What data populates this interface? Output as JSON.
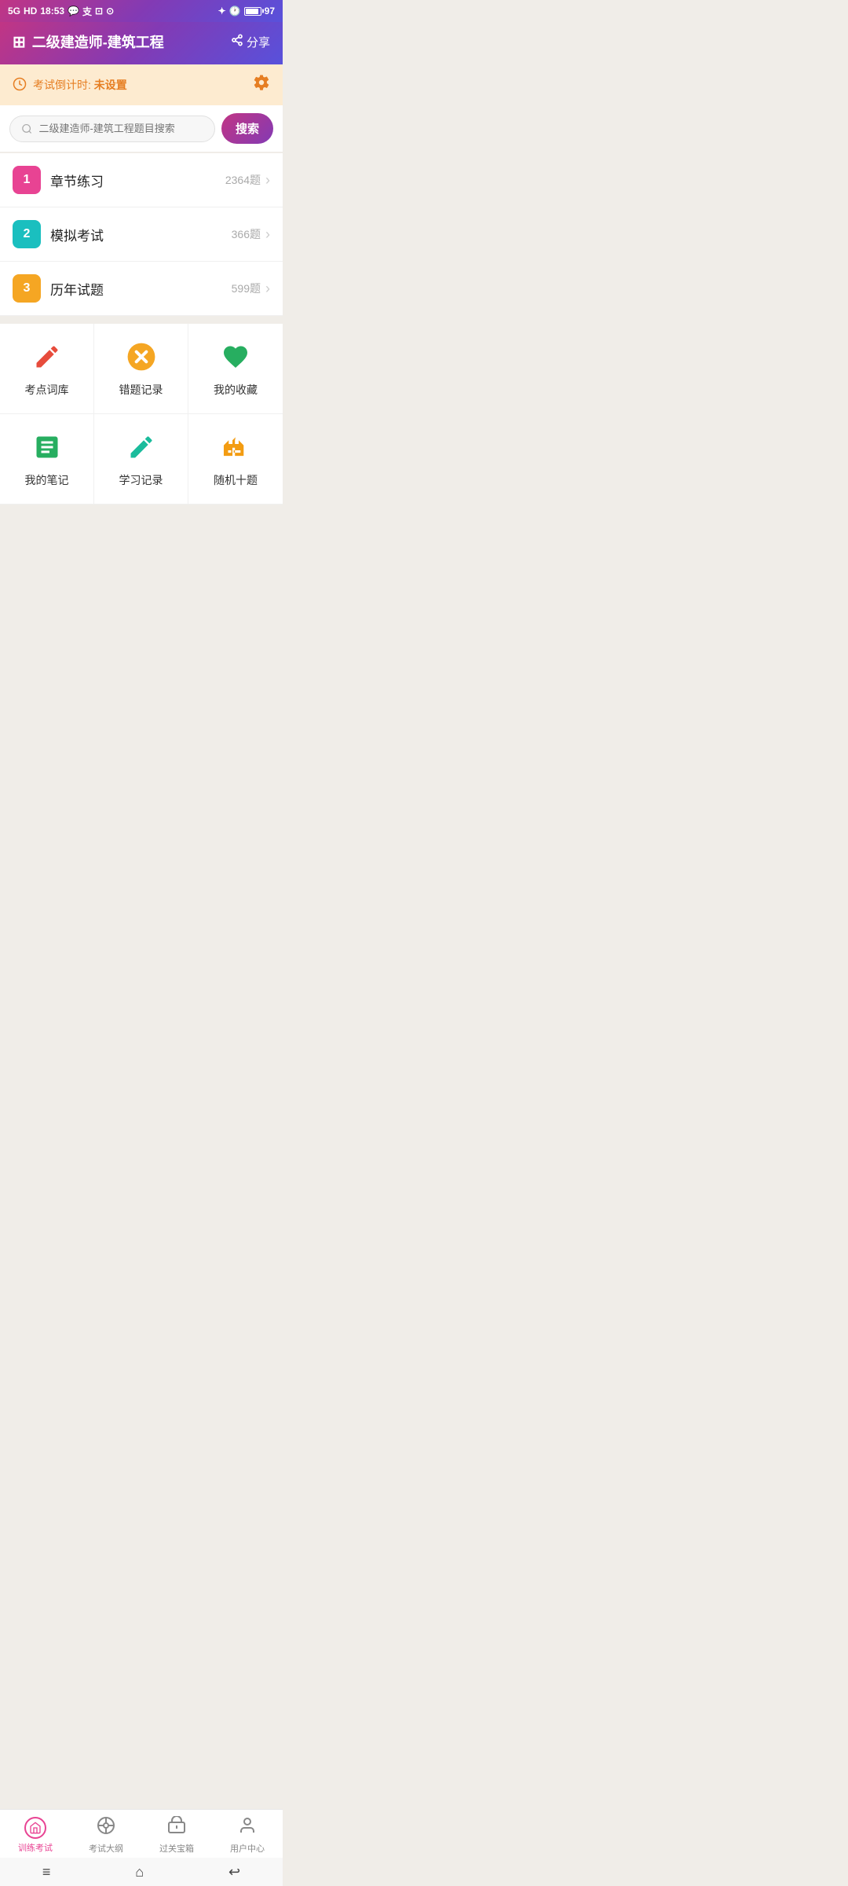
{
  "statusBar": {
    "time": "18:53",
    "signal": "5G",
    "battery": "97"
  },
  "header": {
    "icon": "⊞",
    "title": "二级建造师-建筑工程",
    "shareLabel": "分享"
  },
  "countdown": {
    "label": "考试倒计时:",
    "value": "未设置"
  },
  "search": {
    "placeholder": "二级建造师-建筑工程题目搜索",
    "buttonLabel": "搜索"
  },
  "practiceItems": [
    {
      "num": "1",
      "name": "章节练习",
      "count": "2364题",
      "colorClass": "num-pink"
    },
    {
      "num": "2",
      "name": "模拟考试",
      "count": "366题",
      "colorClass": "num-teal"
    },
    {
      "num": "3",
      "name": "历年试题",
      "count": "599题",
      "colorClass": "num-orange"
    }
  ],
  "features": [
    {
      "id": "kaodian",
      "icon": "✏️",
      "label": "考点词库"
    },
    {
      "id": "cuoti",
      "icon": "❌",
      "label": "错题记录"
    },
    {
      "id": "shoucang",
      "icon": "💚",
      "label": "我的收藏"
    },
    {
      "id": "biji",
      "icon": "📋",
      "label": "我的笔记"
    },
    {
      "id": "xuexi",
      "icon": "✒️",
      "label": "学习记录"
    },
    {
      "id": "suiji",
      "icon": "🔭",
      "label": "随机十题"
    }
  ],
  "bottomNav": [
    {
      "id": "train",
      "label": "训练考试",
      "active": true
    },
    {
      "id": "outline",
      "label": "考试大纲",
      "active": false
    },
    {
      "id": "treasure",
      "label": "过关宝箱",
      "active": false
    },
    {
      "id": "user",
      "label": "用户中心",
      "active": false
    }
  ]
}
